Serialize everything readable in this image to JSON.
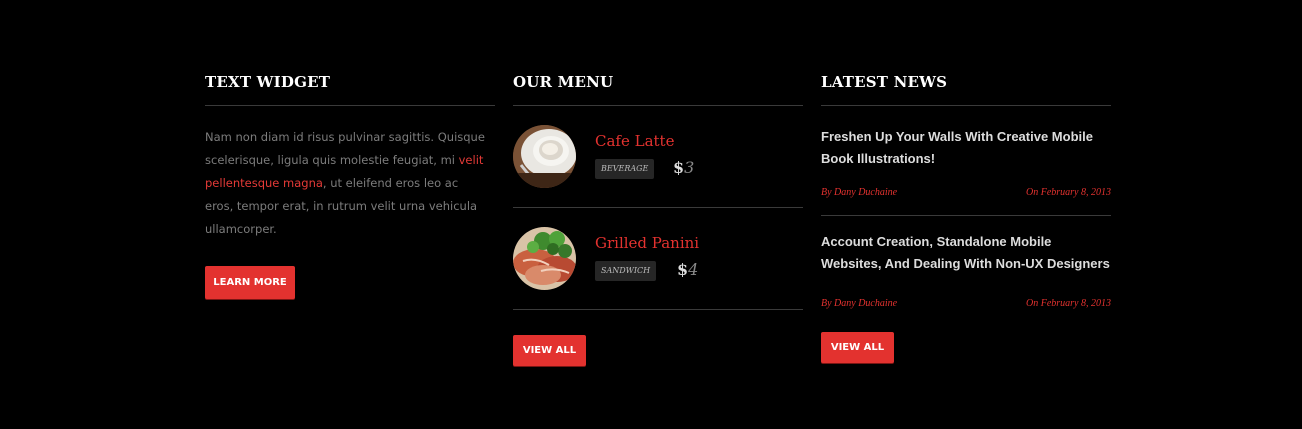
{
  "text_widget": {
    "title": "TEXT WIDGET",
    "text_before": "Nam non diam id risus pulvinar sagittis. Quisque scelerisque, ligula quis molestie feugiat, mi ",
    "link": "velit pellentesque magna",
    "text_after": ", ut eleifend eros leo ac eros, tempor erat, in rutrum velit urna vehicula ullamcorper.",
    "button": "LEARN MORE"
  },
  "menu": {
    "title": "OUR MENU",
    "items": [
      {
        "name": "Cafe Latte",
        "tag": "BEVERAGE",
        "currency": "$",
        "price": "3",
        "icon": "coffee-cup-photo"
      },
      {
        "name": "Grilled Panini",
        "tag": "SANDWICH",
        "currency": "$",
        "price": "4",
        "icon": "panini-photo"
      }
    ],
    "button": "VIEW ALL"
  },
  "news": {
    "title": "LATEST NEWS",
    "items": [
      {
        "title": "Freshen Up Your Walls With Creative Mobile Book Illustrations!",
        "author": "By Dany Duchaine",
        "date": "On February 8, 2013"
      },
      {
        "title": "Account Creation, Standalone Mobile Websites, And Dealing With Non-UX Designers",
        "author": "By Dany Duchaine",
        "date": "On February 8, 2013"
      }
    ],
    "button": "VIEW ALL"
  },
  "colors": {
    "accent": "#e3322f",
    "background": "#000000",
    "divider": "#3a3a3a"
  }
}
